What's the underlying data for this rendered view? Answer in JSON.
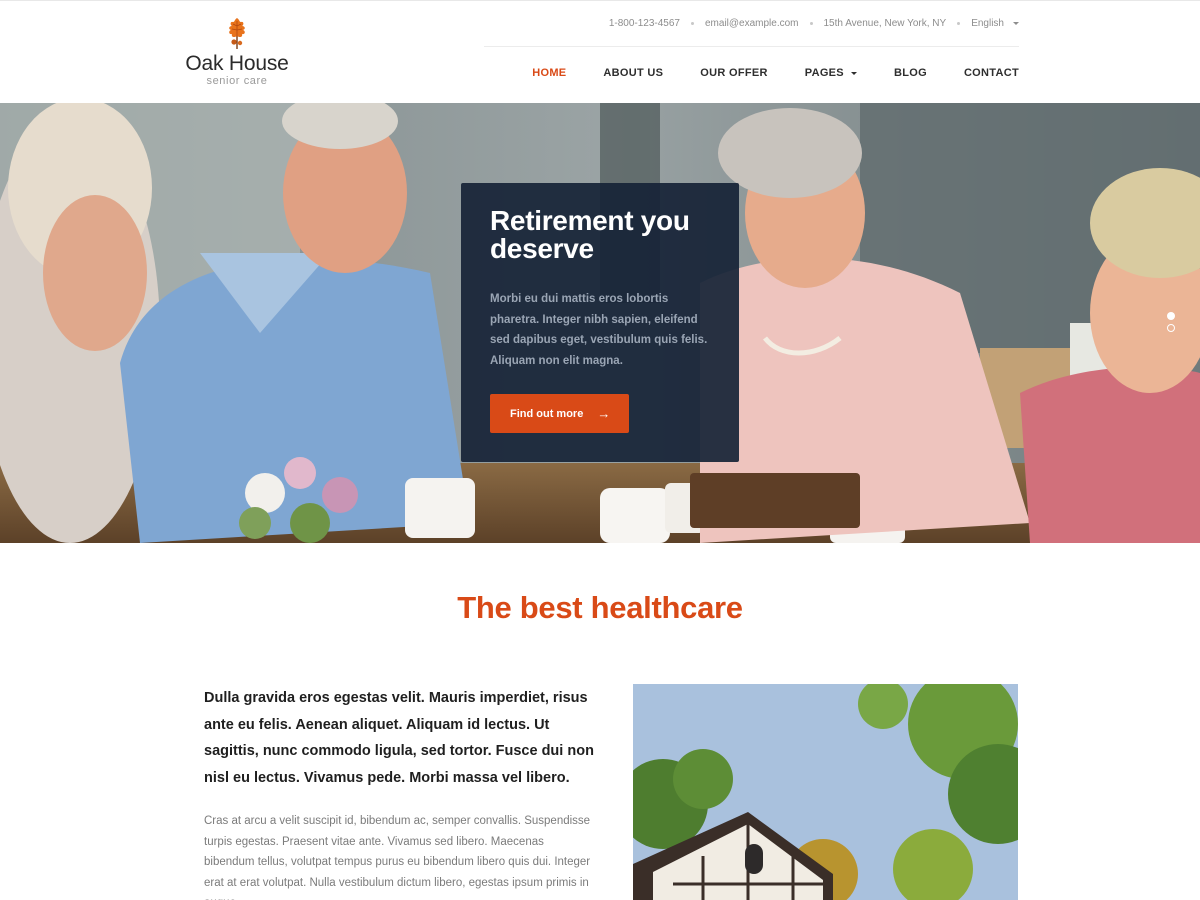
{
  "brand": {
    "name": "Oak House",
    "tagline": "senior care"
  },
  "topbar": {
    "phone": "1-800-123-4567",
    "email": "email@example.com",
    "address": "15th Avenue, New York, NY",
    "language": "English"
  },
  "nav": {
    "items": [
      {
        "label": "HOME",
        "active": true
      },
      {
        "label": "ABOUT US",
        "active": false
      },
      {
        "label": "OUR OFFER",
        "active": false
      },
      {
        "label": "PAGES",
        "active": false,
        "dropdown": true
      },
      {
        "label": "BLOG",
        "active": false
      },
      {
        "label": "CONTACT",
        "active": false
      }
    ]
  },
  "hero": {
    "title": "Retirement you deserve",
    "text": "Morbi eu dui mattis eros lobortis pharetra. Integer nibh sapien, eleifend sed dapibus eget, vestibulum quis felis. Aliquam non elit magna.",
    "button_label": "Find out more",
    "button_arrow": "→",
    "slides": 2,
    "active_slide": 1
  },
  "section": {
    "title": "The best healthcare",
    "lead": "Dulla gravida eros egestas velit. Mauris imperdiet, risus ante eu felis. Aenean aliquet. Aliquam id lectus. Ut sagittis, nunc commodo ligula, sed tortor. Fusce dui non nisl eu lectus. Vivamus pede. Morbi massa vel libero.",
    "body": "Cras at arcu a velit suscipit id, bibendum ac, semper convallis. Suspendisse turpis egestas. Praesent vitae ante. Vivamus sed libero. Maecenas bibendum tellus, volutpat tempus purus eu bibendum libero quis dui. Integer erat at erat volutpat. Nulla vestibulum dictum libero, egestas ipsum primis in augue."
  },
  "colors": {
    "accent": "#d94a17",
    "hero_box": "#162336",
    "text_dark": "#1f1f1f",
    "text_muted": "#7b7b7b"
  },
  "icons": {
    "logo": "oak-leaf-icon",
    "nav_dropdown": "chevron-down-icon",
    "button": "arrow-right-icon"
  }
}
